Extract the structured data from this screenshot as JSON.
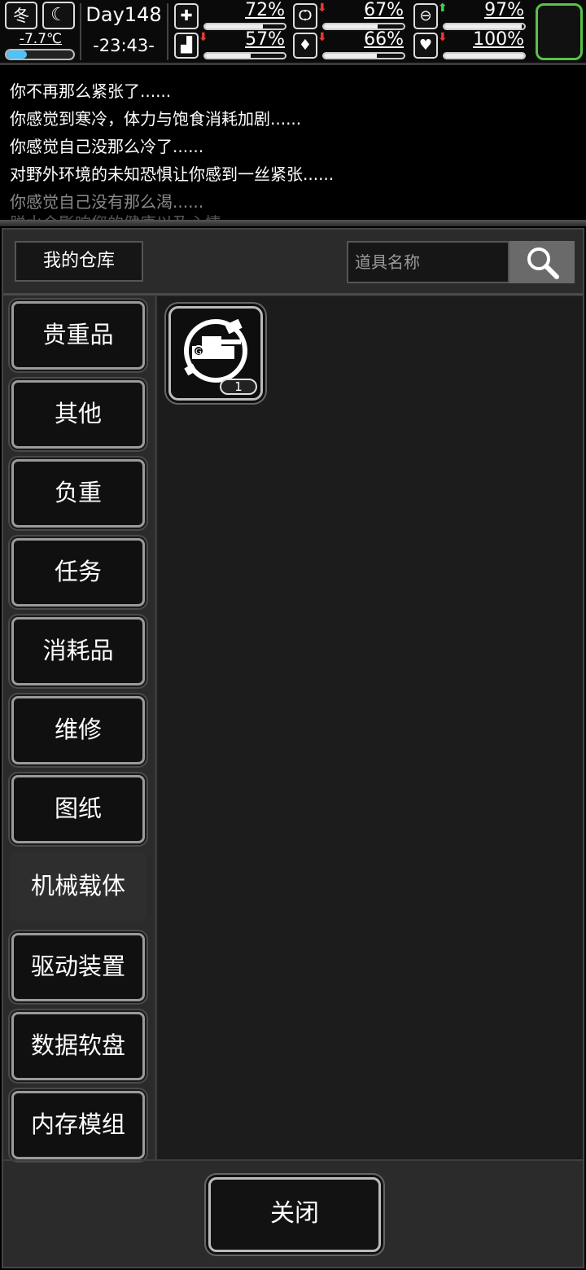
{
  "status": {
    "season": "冬",
    "temperature": "-7.7℃",
    "temperature_level": 0.3,
    "day": "Day148",
    "time": "-23:43-",
    "stats": [
      {
        "id": "health",
        "icon": "medkit-icon",
        "glyph": "✚",
        "value": "72%",
        "level": 0.72,
        "trend": ""
      },
      {
        "id": "hunger",
        "icon": "stomach-icon",
        "glyph": "Ѻ",
        "value": "67%",
        "level": 0.67,
        "trend": "down"
      },
      {
        "id": "pill",
        "icon": "pill-icon",
        "glyph": "⊖",
        "value": "97%",
        "level": 0.97,
        "trend": "up"
      },
      {
        "id": "stamina",
        "icon": "boot-icon",
        "glyph": "▟",
        "value": "57%",
        "level": 0.57,
        "trend": "down"
      },
      {
        "id": "thirst",
        "icon": "water-drop-icon",
        "glyph": "♦",
        "value": "66%",
        "level": 0.66,
        "trend": "down"
      },
      {
        "id": "mood",
        "icon": "heart-icon",
        "glyph": "♥",
        "value": "100%",
        "level": 1.0,
        "trend": "down"
      }
    ]
  },
  "log": {
    "lines": [
      "你不再那么紧张了......",
      "你感觉到寒冷，体力与饱食消耗加剧......",
      "你感觉自己没那么冷了......",
      "对野外环境的未知恐惧让你感到一丝紧张......",
      "你感觉自己没有那么渴......",
      "脱水会影响您的健康以及心情......"
    ]
  },
  "warehouse": {
    "title": "我的仓库",
    "search_placeholder": "道具名称",
    "categories": [
      {
        "label": "贵重品",
        "active": false
      },
      {
        "label": "其他",
        "active": false
      },
      {
        "label": "负重",
        "active": false
      },
      {
        "label": "任务",
        "active": false
      },
      {
        "label": "消耗品",
        "active": false
      },
      {
        "label": "维修",
        "active": false
      },
      {
        "label": "图纸",
        "active": false
      },
      {
        "label": "机械载体",
        "active": true
      },
      {
        "label": "驱动装置",
        "active": false
      },
      {
        "label": "数据软盘",
        "active": false
      },
      {
        "label": "内存模组",
        "active": false
      }
    ],
    "items": [
      {
        "icon": "mech-vehicle-icon",
        "count": "1"
      }
    ],
    "close_label": "关闭"
  },
  "colors": {
    "accent_green": "#59c247",
    "arrow_down": "#e53935",
    "arrow_up": "#43d14a",
    "temp_fill": "#4fc3f7"
  }
}
